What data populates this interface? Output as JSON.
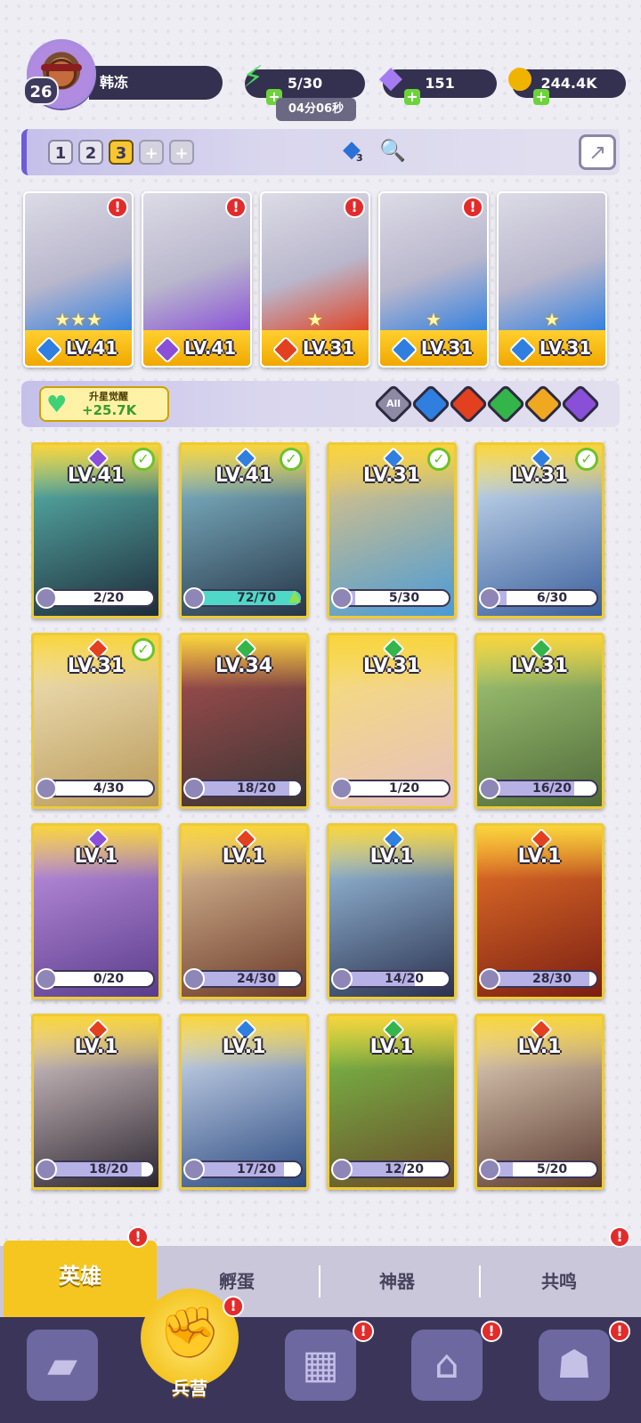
{
  "player": {
    "level": "26",
    "name": "韩冻"
  },
  "resources": {
    "energy": {
      "value": "5/30",
      "icon": "lightning-icon",
      "color": "#45d95a"
    },
    "energy_timer": "04分06秒",
    "gems": {
      "value": "151",
      "icon": "diamond-icon",
      "color": "#a57bf2"
    },
    "coins": {
      "value": "244.4K",
      "icon": "coin-icon",
      "color": "#f0b400"
    }
  },
  "team_tabs": [
    {
      "label": "1",
      "active": false
    },
    {
      "label": "2",
      "active": false
    },
    {
      "label": "3",
      "active": true
    },
    {
      "label": "+",
      "active": false
    },
    {
      "label": "+",
      "active": false
    }
  ],
  "team_bar": {
    "element_count": "3"
  },
  "formation": [
    {
      "level": "LV.41",
      "element": "water",
      "stars": "★★★",
      "alert": true
    },
    {
      "level": "LV.41",
      "element": "dark",
      "stars": "",
      "alert": true
    },
    {
      "level": "LV.31",
      "element": "fire",
      "stars": "★",
      "alert": true
    },
    {
      "level": "LV.31",
      "element": "water",
      "stars": "★",
      "alert": true
    },
    {
      "level": "LV.31",
      "element": "water",
      "stars": "★",
      "alert": false
    }
  ],
  "awaken": {
    "title": "升星觉醒",
    "value": "+25.7K"
  },
  "filters": [
    {
      "label": "All",
      "element": "all"
    },
    {
      "label": "",
      "element": "water"
    },
    {
      "label": "",
      "element": "fire"
    },
    {
      "label": "",
      "element": "wind"
    },
    {
      "label": "",
      "element": "light"
    },
    {
      "label": "",
      "element": "dark"
    }
  ],
  "element_colors": {
    "water": "#2f7fe0",
    "dark": "#8a4fd8",
    "fire": "#e2401f",
    "wind": "#34b54a",
    "light": "#f0a820",
    "all": "#8e8aa6"
  },
  "heroes": [
    {
      "level": "LV.41",
      "element": "dark",
      "progress": "2/20",
      "check": true,
      "art": [
        "#1e2b3a",
        "#5fc3b8"
      ]
    },
    {
      "level": "LV.41",
      "element": "water",
      "progress": "72/70",
      "check": true,
      "up": true,
      "art": [
        "#263648",
        "#8cc6d8"
      ]
    },
    {
      "level": "LV.31",
      "element": "water",
      "progress": "5/30",
      "check": true,
      "art": [
        "#4a9ad8",
        "#f0c87a"
      ]
    },
    {
      "level": "LV.31",
      "element": "water",
      "progress": "6/30",
      "check": true,
      "art": [
        "#3b5f9c",
        "#d9eaf8"
      ]
    },
    {
      "level": "LV.31",
      "element": "fire",
      "progress": "4/30",
      "check": true,
      "art": [
        "#b99a5a",
        "#f6e8c0"
      ]
    },
    {
      "level": "LV.34",
      "element": "wind",
      "progress": "18/20",
      "check": false,
      "art": [
        "#3a3434",
        "#b05050"
      ]
    },
    {
      "level": "LV.31",
      "element": "wind",
      "progress": "1/20",
      "check": false,
      "art": [
        "#e6c0c0",
        "#f8e070"
      ]
    },
    {
      "level": "LV.31",
      "element": "wind",
      "progress": "16/20",
      "check": false,
      "art": [
        "#4f6a3a",
        "#a9d07a"
      ]
    },
    {
      "level": "LV.1",
      "element": "dark",
      "progress": "0/20",
      "check": false,
      "art": [
        "#5a3c8c",
        "#c89ae8"
      ]
    },
    {
      "level": "LV.1",
      "element": "fire",
      "progress": "24/30",
      "check": false,
      "art": [
        "#6a3a2a",
        "#e6c8a0"
      ]
    },
    {
      "level": "LV.1",
      "element": "water",
      "progress": "14/20",
      "check": false,
      "art": [
        "#2a3250",
        "#a8d0ee"
      ]
    },
    {
      "level": "LV.1",
      "element": "fire",
      "progress": "28/30",
      "check": false,
      "art": [
        "#7a1e14",
        "#f07a2a"
      ]
    },
    {
      "level": "LV.1",
      "element": "fire",
      "progress": "18/20",
      "check": false,
      "art": [
        "#2c2630",
        "#e8d8d8"
      ]
    },
    {
      "level": "LV.1",
      "element": "water",
      "progress": "17/20",
      "check": false,
      "art": [
        "#2a4a80",
        "#dfe8f8"
      ]
    },
    {
      "level": "LV.1",
      "element": "wind",
      "progress": "12/20",
      "check": false,
      "art": [
        "#6a4a2a",
        "#7ac84a"
      ]
    },
    {
      "level": "LV.1",
      "element": "fire",
      "progress": "5/20",
      "check": false,
      "art": [
        "#5a3a30",
        "#f0e0c8"
      ]
    }
  ],
  "sub_tabs": [
    {
      "label": "英雄",
      "active": true,
      "alert": true
    },
    {
      "label": "孵蛋",
      "active": false,
      "alert": false
    },
    {
      "label": "神器",
      "active": false,
      "alert": false
    },
    {
      "label": "共鸣",
      "active": false,
      "alert": true
    }
  ],
  "bottom_nav": [
    {
      "icon": "cards-icon",
      "label": "",
      "active": false,
      "alert": false
    },
    {
      "icon": "barracks-icon",
      "label": "兵营",
      "active": true,
      "alert": true
    },
    {
      "icon": "map-icon",
      "label": "",
      "active": false,
      "alert": true
    },
    {
      "icon": "castle-icon",
      "label": "",
      "active": false,
      "alert": true
    },
    {
      "icon": "mushroom-icon",
      "label": "",
      "active": false,
      "alert": true
    }
  ]
}
